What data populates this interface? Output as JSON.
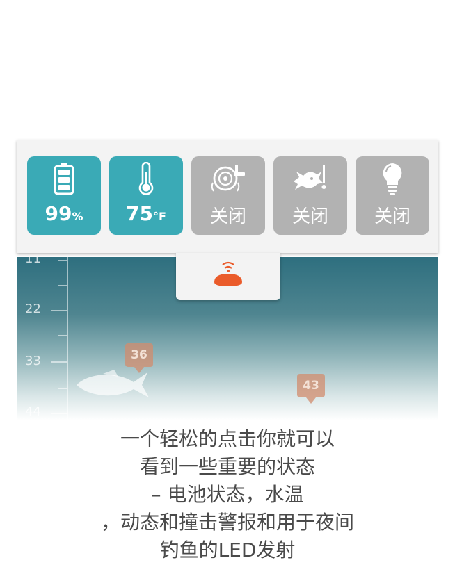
{
  "status_tiles": [
    {
      "icon": "battery-icon",
      "value": "99",
      "unit": "%",
      "active": true
    },
    {
      "icon": "thermometer-icon",
      "value": "75",
      "unit": "°F",
      "active": true
    },
    {
      "icon": "alarm-bell-icon",
      "value": "关闭",
      "active": false
    },
    {
      "icon": "fish-alarm-icon",
      "value": "关闭",
      "active": false
    },
    {
      "icon": "light-bulb-icon",
      "value": "关闭",
      "active": false
    }
  ],
  "sonar": {
    "depth_labels": [
      "11",
      "22",
      "33",
      "44"
    ],
    "fish_tags": [
      "36",
      "43"
    ]
  },
  "colors": {
    "accent": "#3aaab6",
    "inactive": "#b2b2b2",
    "device": "#ea5b2a"
  },
  "caption_lines": [
    "一个轻松的点击你就可以",
    "看到一些重要的状态",
    "– 电池状态，水温",
    "，动态和撞击警报和用于夜间",
    "钓鱼的LED发射"
  ]
}
